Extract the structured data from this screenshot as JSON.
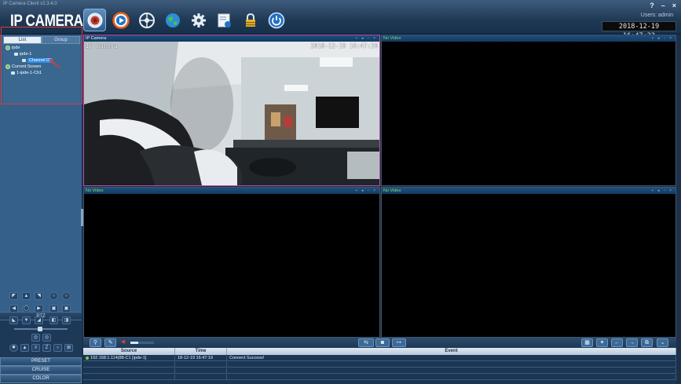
{
  "app": {
    "window_title": "IP Camera Client v2.3.4.0",
    "logo": "IP CAMERA",
    "users_label": "Users: admin",
    "datetime": "2018-12-19 16:47:23",
    "window_controls": [
      "?",
      "–",
      "×"
    ]
  },
  "toolbar": [
    {
      "name": "live-view",
      "icon": "camera-icon",
      "active": true
    },
    {
      "name": "playback",
      "icon": "play-icon",
      "active": false
    },
    {
      "name": "ptz-control",
      "icon": "steering-icon",
      "active": false
    },
    {
      "name": "e-map",
      "icon": "globe-icon",
      "active": false
    },
    {
      "name": "settings",
      "icon": "gear-icon",
      "active": false
    },
    {
      "name": "device",
      "icon": "device-icon",
      "active": false
    },
    {
      "name": "lock",
      "icon": "lock-icon",
      "active": false
    },
    {
      "name": "power",
      "icon": "power-icon",
      "active": false
    }
  ],
  "left_panel": {
    "tabs": {
      "list": "List",
      "group": "Group"
    },
    "tree": {
      "root": "ipde",
      "device": "ipde-1",
      "channel": "Channel 01",
      "current_screen": "Current Screen",
      "current_item": "1-ipde-1-Ch1"
    },
    "ptz_label": "PTZ",
    "buttons": {
      "preset": "PRESET",
      "cruise": "CRUISE",
      "color": "COLOR"
    }
  },
  "video": {
    "panes": [
      {
        "title": "IP Camera",
        "osd_name": "IP Camera",
        "osd_time": "2018-12-19 16:47:20",
        "active": true,
        "has_video": true
      },
      {
        "title": "No Video",
        "active": false,
        "has_video": false
      },
      {
        "title": "No Video",
        "active": false,
        "has_video": false
      },
      {
        "title": "No Video",
        "active": false,
        "has_video": false
      }
    ]
  },
  "events": {
    "headers": {
      "source": "Source",
      "time": "Time",
      "event": "Event"
    },
    "rows": [
      {
        "source": "192.168.1.114(88-C1 [ipde-1]",
        "time": "18-12-19 16:47:19",
        "event": "Connect Success!"
      }
    ]
  }
}
